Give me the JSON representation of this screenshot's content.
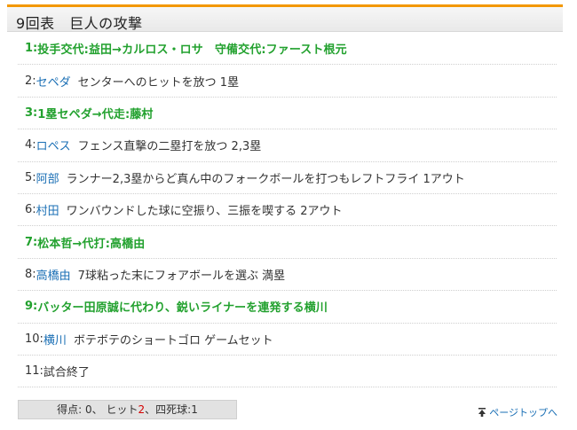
{
  "header": {
    "title": "9回表　巨人の攻撃"
  },
  "plays": [
    {
      "num": "1:",
      "batter": "",
      "text": "投手交代:益田→カルロス・ロサ　守備交代:ファースト根元",
      "sub": true
    },
    {
      "num": "2:",
      "batter": "セペダ",
      "text": "センターへのヒットを放つ 1塁",
      "sub": false
    },
    {
      "num": "3:",
      "batter": "",
      "text": "1塁セペダ→代走:藤村",
      "sub": true
    },
    {
      "num": "4:",
      "batter": "ロペス",
      "text": "フェンス直撃の二塁打を放つ 2,3塁",
      "sub": false
    },
    {
      "num": "5:",
      "batter": "阿部",
      "text": "ランナー2,3塁からど真ん中のフォークボールを打つもレフトフライ 1アウト",
      "sub": false
    },
    {
      "num": "6:",
      "batter": "村田",
      "text": "ワンバウンドした球に空振り、三振を喫する 2アウト",
      "sub": false
    },
    {
      "num": "7:",
      "batter": "",
      "text": "松本哲→代打:高橋由",
      "sub": true
    },
    {
      "num": "8:",
      "batter": "高橋由",
      "text": "7球粘った末にフォアボールを選ぶ 満塁",
      "sub": false
    },
    {
      "num": "9:",
      "batter": "",
      "text": "バッター田原誠に代わり、鋭いライナーを連発する横川",
      "sub": true
    },
    {
      "num": "10:",
      "batter": "横川",
      "text": "ボテボテのショートゴロ ゲームセット",
      "sub": false
    },
    {
      "num": "11:",
      "batter": "",
      "text": "試合終了",
      "sub": false
    }
  ],
  "summary": {
    "runs_label": "得点:",
    "runs": "0",
    "hits_label": "ヒット",
    "hits": "2",
    "walks_label": "四死球:",
    "walks": "1"
  },
  "footer": {
    "page_top_label": "ページトップへ"
  },
  "colors": {
    "accent": "#f39800",
    "substitution": "#22a12e",
    "link": "#1a6fb5",
    "hits": "#d40000"
  }
}
